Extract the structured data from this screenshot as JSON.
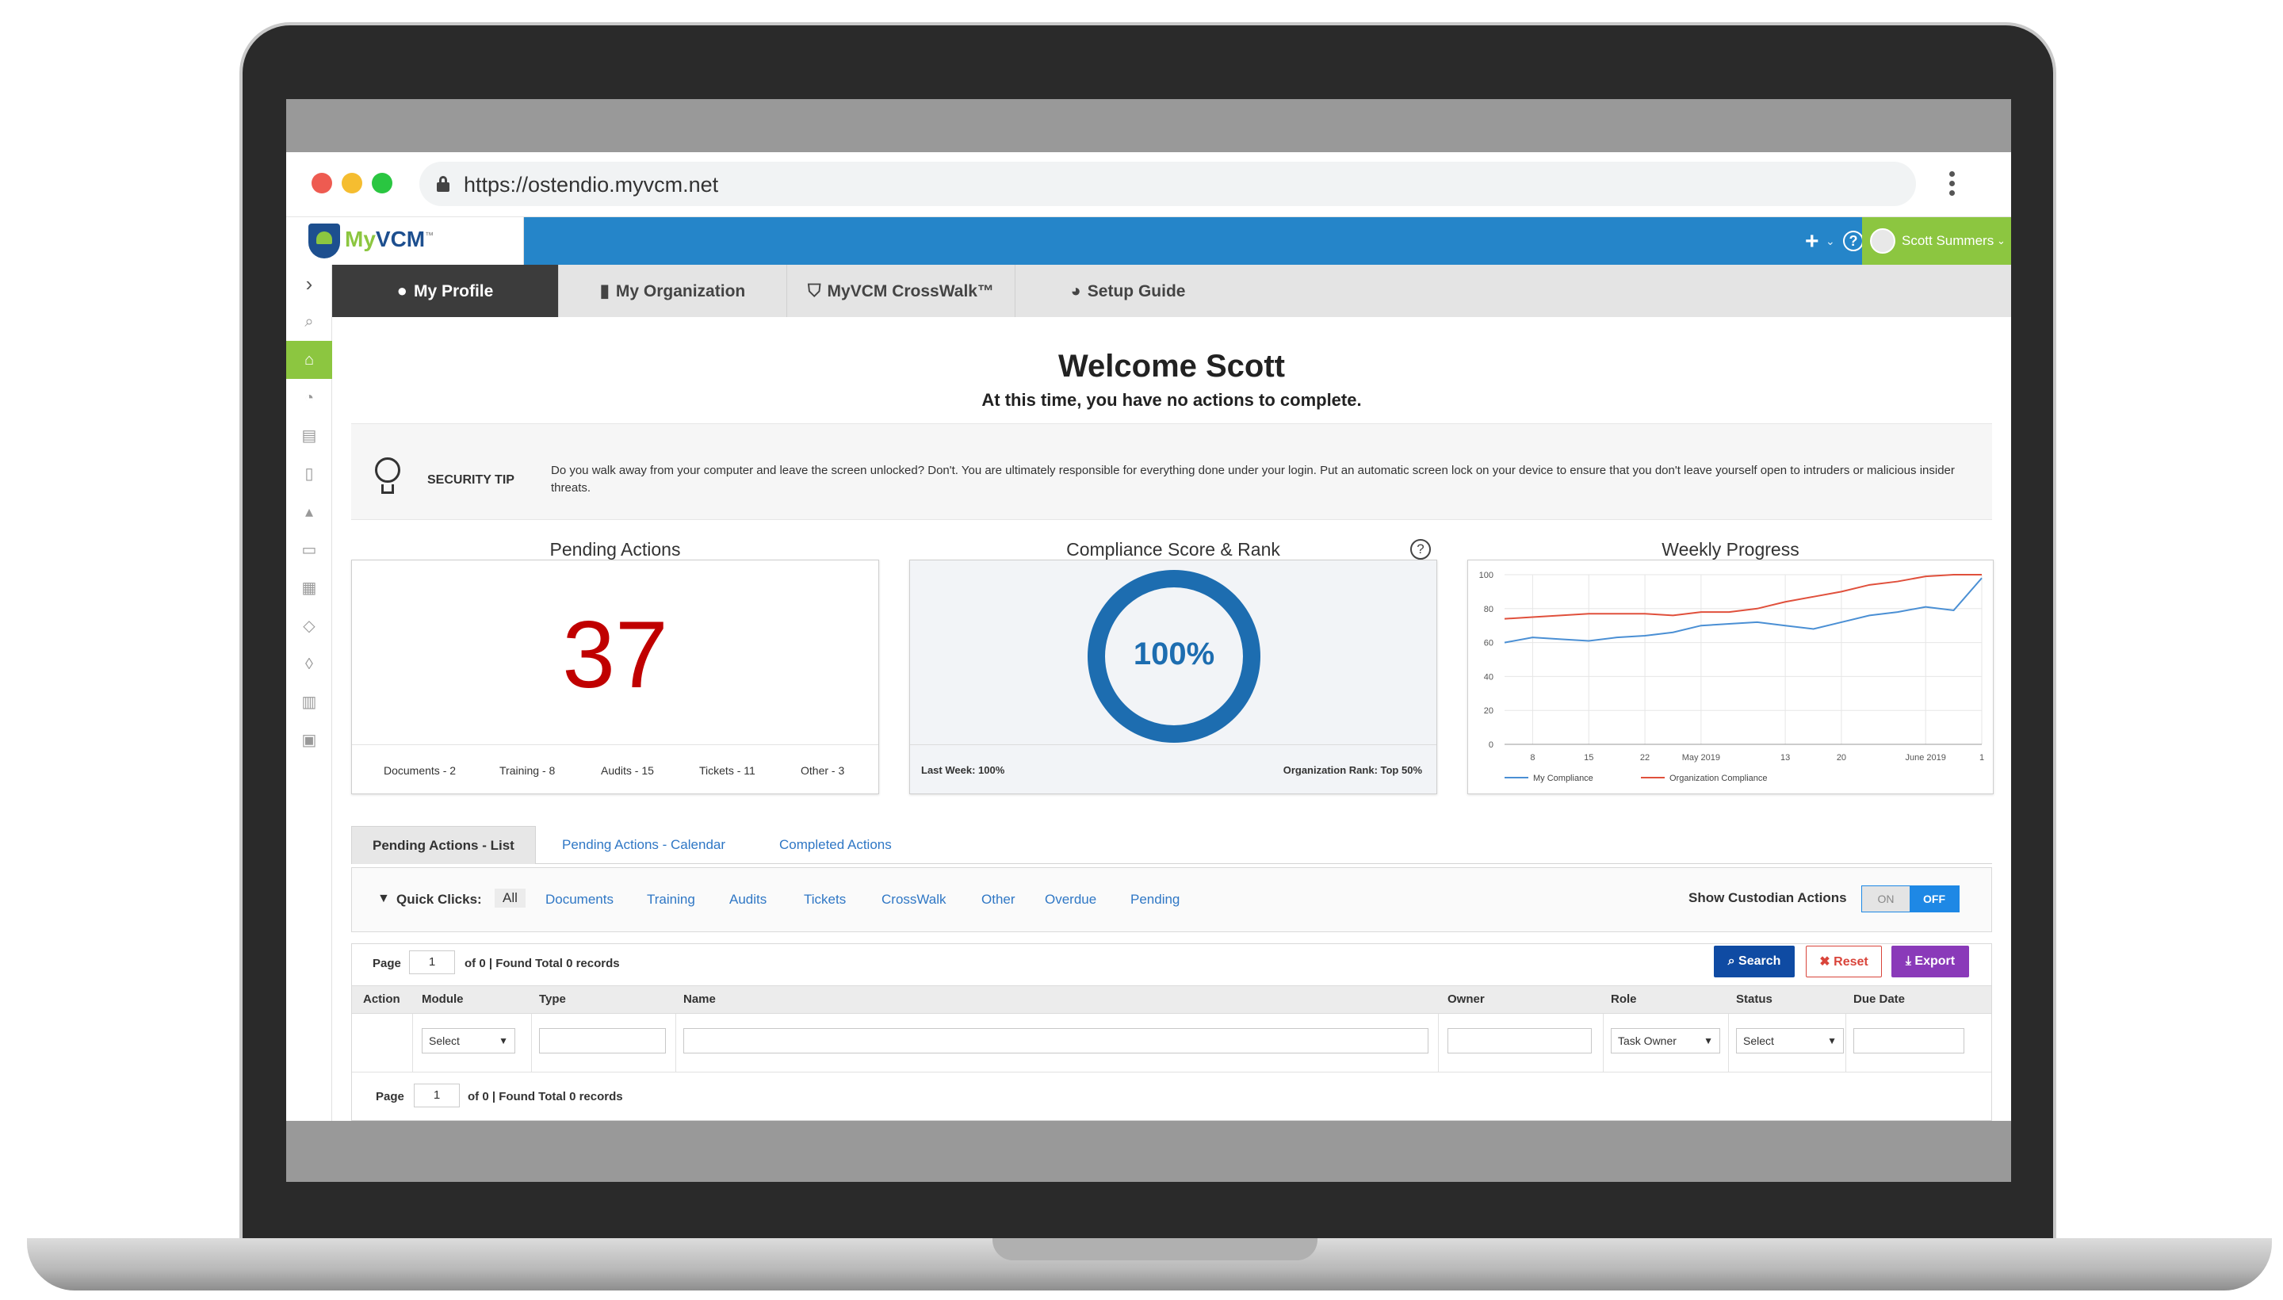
{
  "browser": {
    "url": "https://ostendio.myvcm.net"
  },
  "app": {
    "logo_prefix": "My",
    "logo_suffix": "VCM",
    "logo_tm": "™",
    "header_icons": {
      "add": "+",
      "help": "?",
      "menu": "≡",
      "caret": "⌄"
    },
    "user_name": "Scott Summers"
  },
  "left_rail": {
    "toggle": "›",
    "items": [
      {
        "icon": "search-icon",
        "glyph": "⌕"
      },
      {
        "icon": "home-icon",
        "glyph": "⌂",
        "active": true
      },
      {
        "icon": "gauge-icon",
        "glyph": "◔"
      },
      {
        "icon": "book-icon",
        "glyph": "▤"
      },
      {
        "icon": "document-icon",
        "glyph": "▯"
      },
      {
        "icon": "graduation-cap-icon",
        "glyph": "▴"
      },
      {
        "icon": "folder-icon",
        "glyph": "▭"
      },
      {
        "icon": "grid-icon",
        "glyph": "▦"
      },
      {
        "icon": "layers-icon",
        "glyph": "◇"
      },
      {
        "icon": "tag-icon",
        "glyph": "◊"
      },
      {
        "icon": "bar-chart-icon",
        "glyph": "▥"
      },
      {
        "icon": "gift-icon",
        "glyph": "▣"
      }
    ]
  },
  "tabs": {
    "profile": {
      "label": "My Profile",
      "glyph": "●"
    },
    "organization": {
      "label": "My Organization",
      "glyph": "▮"
    },
    "crosswalk": {
      "label": "MyVCM CrossWalk™",
      "glyph": "⛉"
    },
    "setup": {
      "label": "Setup Guide",
      "glyph": "◕"
    }
  },
  "welcome": {
    "title": "Welcome Scott",
    "subtitle": "At this time, you have no actions to complete."
  },
  "security_tip": {
    "label": "SECURITY TIP",
    "text": "Do you walk away from your computer and leave the screen unlocked? Don't. You are ultimately responsible for everything done under your login. Put an automatic screen lock on your device to ensure that you don't leave yourself open to intruders or malicious insider threats."
  },
  "pending_actions": {
    "title": "Pending Actions",
    "count": "37",
    "documents": "Documents - 2",
    "training": "Training - 8",
    "audits": "Audits - 15",
    "tickets": "Tickets - 11",
    "other": "Other - 3"
  },
  "compliance": {
    "title": "Compliance Score & Rank",
    "help_glyph": "?",
    "score": "100%",
    "score_value": 100,
    "last_week": "Last Week: 100%",
    "org_rank": "Organization Rank:  Top 50%"
  },
  "weekly_progress": {
    "title": "Weekly Progress"
  },
  "chart_data": {
    "type": "line",
    "title": "Weekly Progress",
    "x": [
      "",
      "8",
      "",
      "15",
      "",
      "22",
      "",
      "May 2019",
      "",
      "",
      "13",
      "",
      "20",
      "",
      "",
      "June 2019",
      "",
      "1"
    ],
    "x_tick_labels": [
      "8",
      "15",
      "22",
      "May 2019",
      "13",
      "20",
      "June 2019",
      "1"
    ],
    "ylim": [
      0,
      100
    ],
    "y_ticks": [
      0,
      20,
      40,
      60,
      80,
      100
    ],
    "grid": true,
    "legend_placement": "bottom-left",
    "series": [
      {
        "name": "My Compliance",
        "color": "#4a8fd4",
        "values": [
          60,
          63,
          62,
          61,
          63,
          64,
          66,
          70,
          71,
          72,
          70,
          68,
          72,
          76,
          78,
          81,
          79,
          98
        ]
      },
      {
        "name": "Organization Compliance",
        "color": "#e0503c",
        "values": [
          74,
          75,
          76,
          77,
          77,
          77,
          76,
          78,
          78,
          80,
          84,
          87,
          90,
          94,
          96,
          99,
          100,
          100
        ]
      }
    ]
  },
  "lower_tabs": {
    "list": "Pending Actions - List",
    "calendar": "Pending Actions - Calendar",
    "completed": "Completed Actions"
  },
  "quick_clicks": {
    "label": "Quick Clicks:",
    "items": [
      "All",
      "Documents",
      "Training",
      "Audits",
      "Tickets",
      "CrossWalk",
      "Other",
      "Overdue",
      "Pending"
    ],
    "custodian_label": "Show Custodian Actions",
    "toggle_on": "ON",
    "toggle_off": "OFF"
  },
  "grid": {
    "page_label": "Page",
    "page_value": "1",
    "records_text": "of 0 | Found Total 0 records",
    "search": "Search",
    "reset": "Reset",
    "export": "Export",
    "columns": [
      "Action",
      "Module",
      "Type",
      "Name",
      "Owner",
      "Role",
      "Status",
      "Due Date"
    ],
    "module_select": "Select",
    "role_select": "Task Owner",
    "status_select": "Select"
  }
}
